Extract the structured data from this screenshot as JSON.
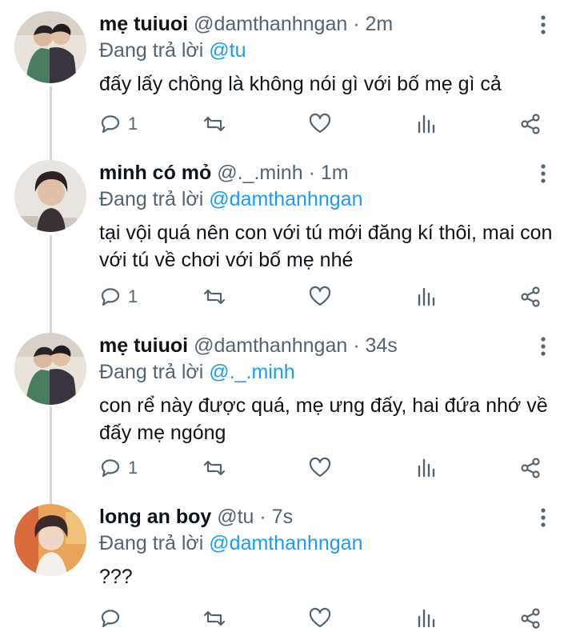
{
  "colors": {
    "accent": "#1d9bf0",
    "secondary_text": "#536471",
    "thread_line": "#cfd9de"
  },
  "tweets": [
    {
      "name": "mẹ tuiuoi",
      "handle": "@damthanhngan",
      "time": "2m",
      "reply_label": "Đang trả lời",
      "reply_to": "@tu",
      "text": "đấy lấy chồng là không nói gì với bố mẹ gì cả",
      "reply_count": "1"
    },
    {
      "name": "minh có mỏ",
      "handle": "@._.minh",
      "time": "1m",
      "reply_label": "Đang trả lời",
      "reply_to": "@damthanhngan",
      "text": "tại vội quá nên con với tú mới đăng kí thôi, mai con với tú về chơi với bố mẹ nhé",
      "reply_count": "1"
    },
    {
      "name": "mẹ tuiuoi",
      "handle": "@damthanhngan",
      "time": "34s",
      "reply_label": "Đang trả lời",
      "reply_to": "@._.minh",
      "text": "con rể này được quá, mẹ ưng đấy, hai đứa nhớ về đấy mẹ ngóng",
      "reply_count": "1"
    },
    {
      "name": "long an boy",
      "handle": "@tu",
      "time": "7s",
      "reply_label": "Đang trả lời",
      "reply_to": "@damthanhngan",
      "text": "???",
      "reply_count": ""
    }
  ],
  "icons": {
    "reply": "reply-icon",
    "retweet": "retweet-icon",
    "like": "heart-icon",
    "views": "analytics-icon",
    "share": "share-icon",
    "more": "more-options-icon"
  },
  "separator": "·"
}
